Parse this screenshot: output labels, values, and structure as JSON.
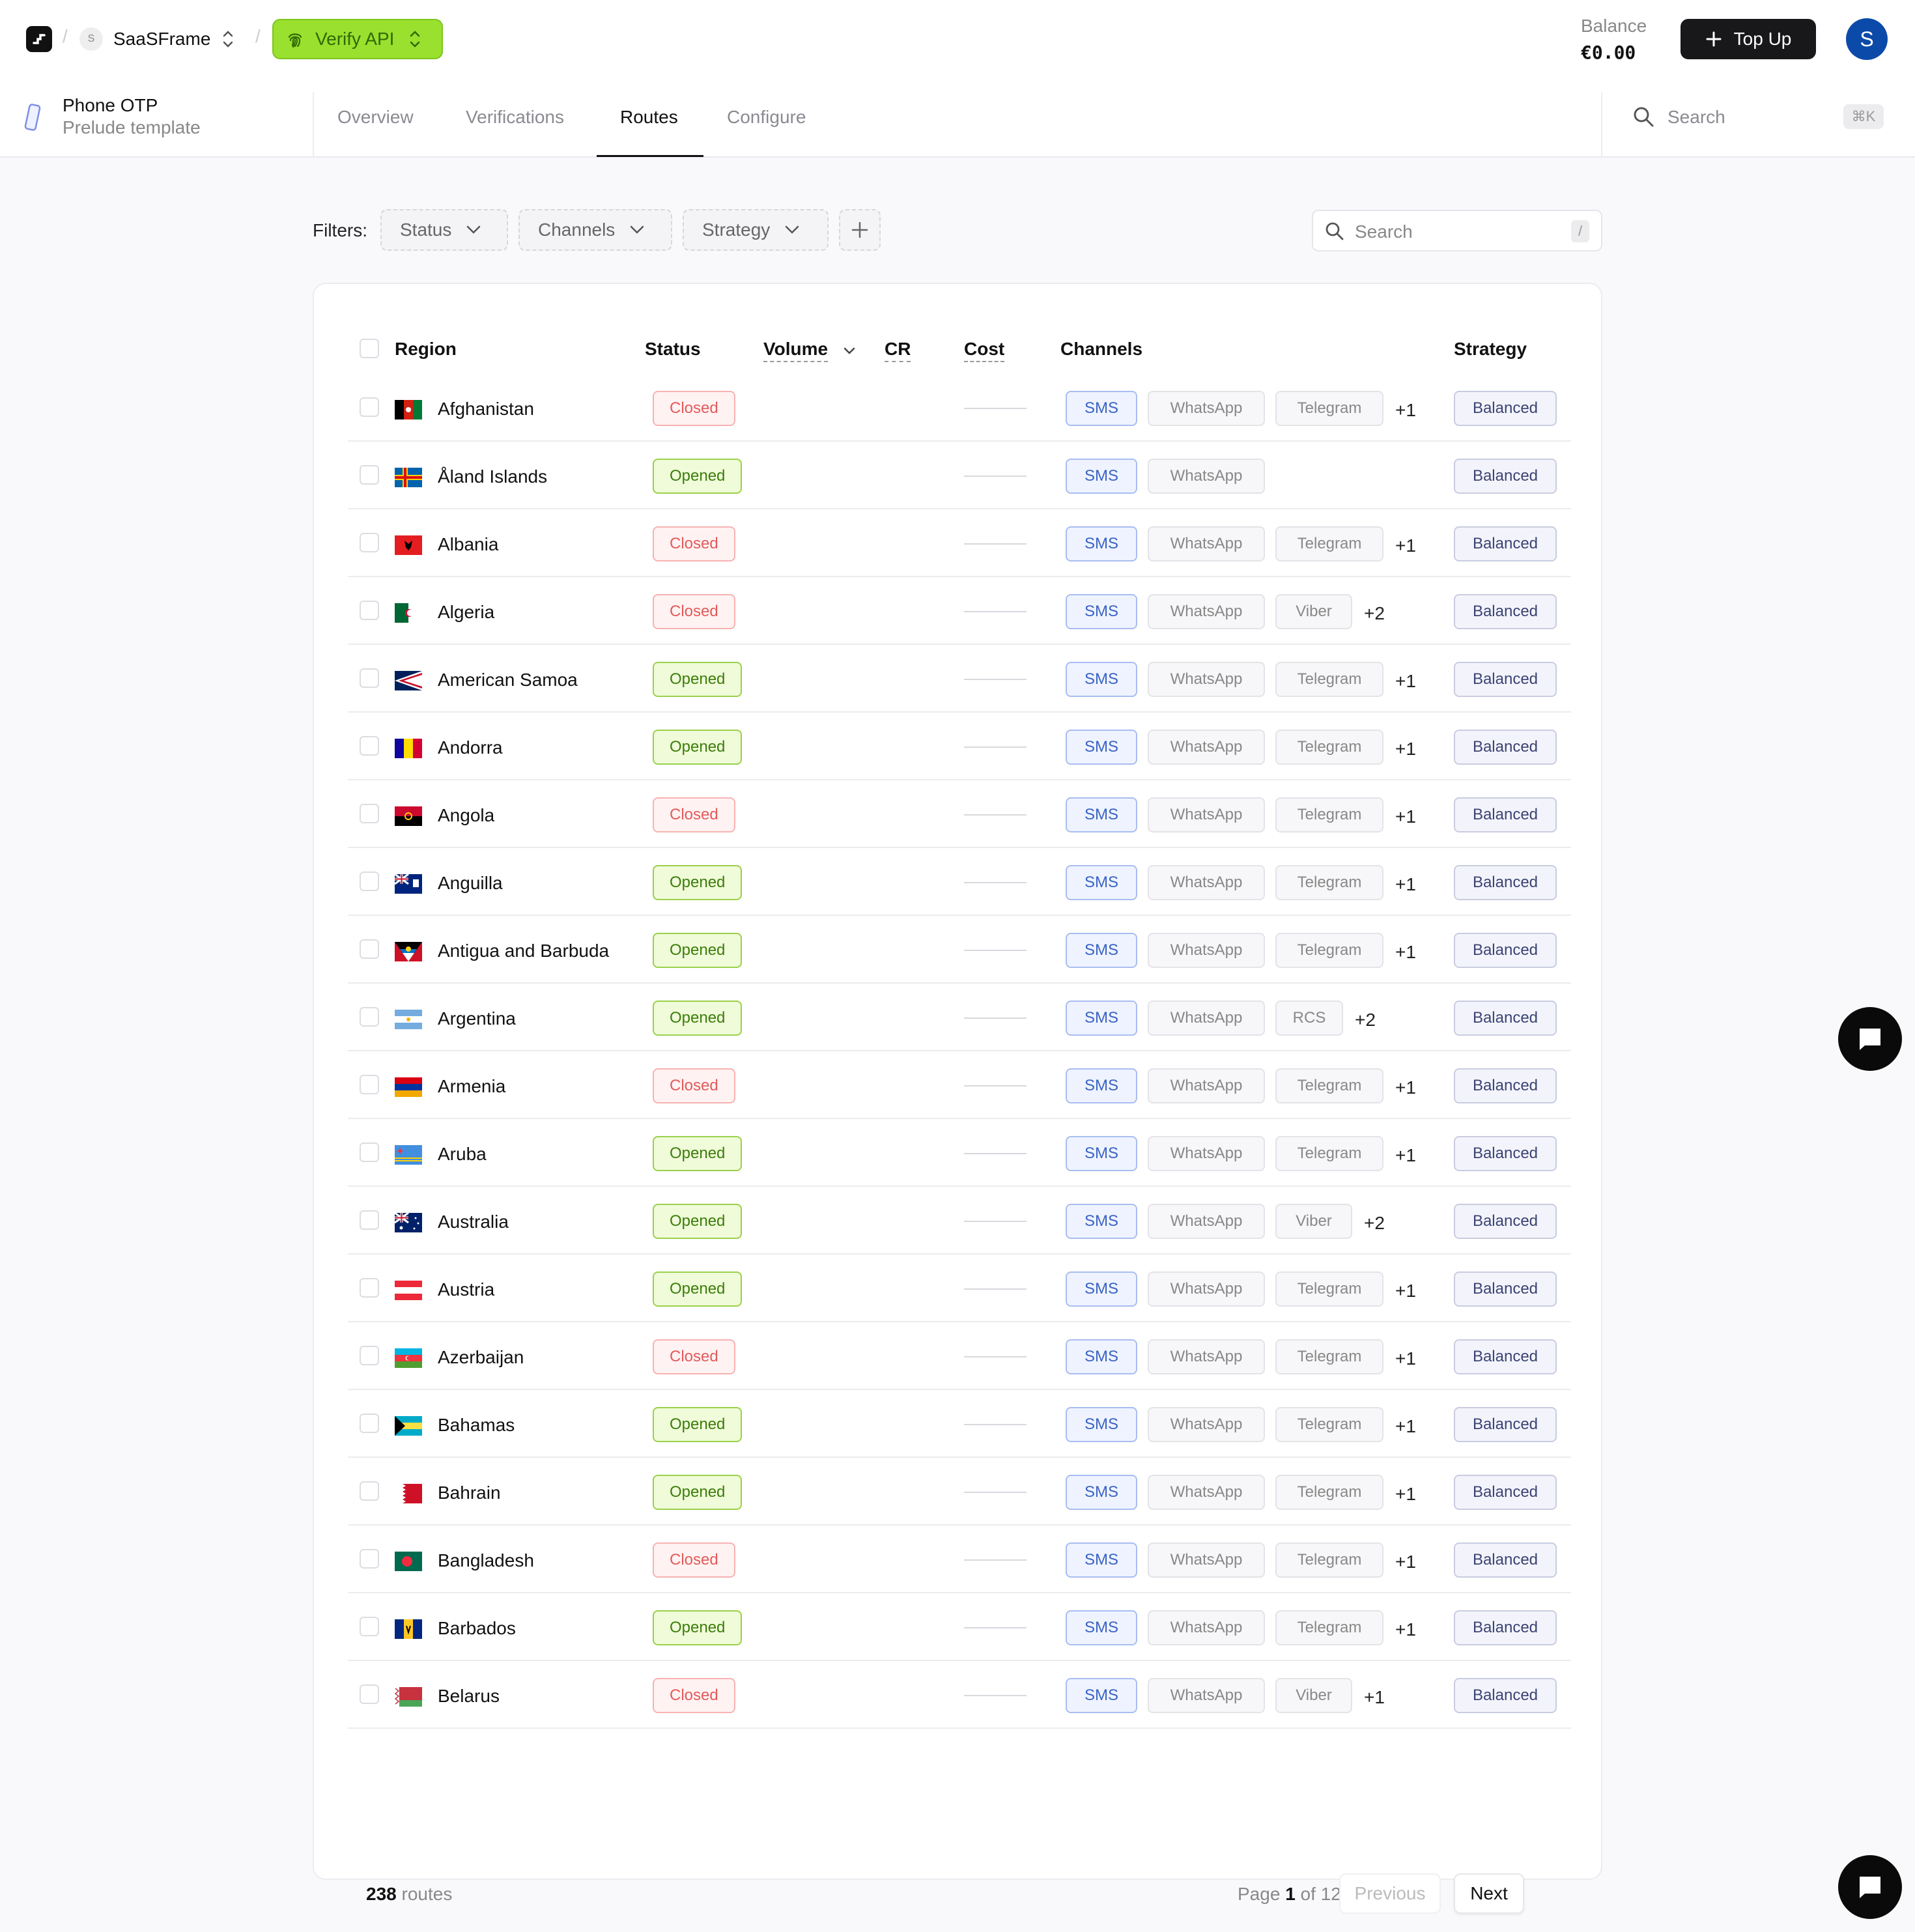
{
  "header": {
    "workspace_initial": "S",
    "workspace_name": "SaaSFrame",
    "product_label": "Verify API",
    "balance_label": "Balance",
    "balance_value": "€0.00",
    "topup_label": "Top Up",
    "user_initial": "S"
  },
  "project": {
    "title": "Phone OTP",
    "subtitle": "Prelude template"
  },
  "tabs": [
    {
      "label": "Overview",
      "active": false
    },
    {
      "label": "Verifications",
      "active": false
    },
    {
      "label": "Routes",
      "active": true
    },
    {
      "label": "Configure",
      "active": false
    }
  ],
  "global_search": {
    "placeholder": "Search",
    "shortcut": "⌘K"
  },
  "filters": {
    "label": "Filters:",
    "chips": [
      "Status",
      "Channels",
      "Strategy"
    ]
  },
  "table_search": {
    "placeholder": "Search",
    "shortcut": "/"
  },
  "table": {
    "columns": {
      "region": "Region",
      "status": "Status",
      "volume": "Volume",
      "cr": "CR",
      "cost": "Cost",
      "channels": "Channels",
      "strategy": "Strategy"
    },
    "rows": [
      {
        "region": "Afghanistan",
        "status": "Closed",
        "channels": [
          "SMS",
          "WhatsApp",
          "Telegram"
        ],
        "more": "+1",
        "strategy": "Balanced",
        "flag": "af"
      },
      {
        "region": "Åland Islands",
        "status": "Opened",
        "channels": [
          "SMS",
          "WhatsApp"
        ],
        "more": "",
        "strategy": "Balanced",
        "flag": "ax"
      },
      {
        "region": "Albania",
        "status": "Closed",
        "channels": [
          "SMS",
          "WhatsApp",
          "Telegram"
        ],
        "more": "+1",
        "strategy": "Balanced",
        "flag": "al"
      },
      {
        "region": "Algeria",
        "status": "Closed",
        "channels": [
          "SMS",
          "WhatsApp",
          "Viber"
        ],
        "more": "+2",
        "strategy": "Balanced",
        "flag": "dz"
      },
      {
        "region": "American Samoa",
        "status": "Opened",
        "channels": [
          "SMS",
          "WhatsApp",
          "Telegram"
        ],
        "more": "+1",
        "strategy": "Balanced",
        "flag": "as"
      },
      {
        "region": "Andorra",
        "status": "Opened",
        "channels": [
          "SMS",
          "WhatsApp",
          "Telegram"
        ],
        "more": "+1",
        "strategy": "Balanced",
        "flag": "ad"
      },
      {
        "region": "Angola",
        "status": "Closed",
        "channels": [
          "SMS",
          "WhatsApp",
          "Telegram"
        ],
        "more": "+1",
        "strategy": "Balanced",
        "flag": "ao"
      },
      {
        "region": "Anguilla",
        "status": "Opened",
        "channels": [
          "SMS",
          "WhatsApp",
          "Telegram"
        ],
        "more": "+1",
        "strategy": "Balanced",
        "flag": "ai"
      },
      {
        "region": "Antigua and Barbuda",
        "status": "Opened",
        "channels": [
          "SMS",
          "WhatsApp",
          "Telegram"
        ],
        "more": "+1",
        "strategy": "Balanced",
        "flag": "ag"
      },
      {
        "region": "Argentina",
        "status": "Opened",
        "channels": [
          "SMS",
          "WhatsApp",
          "RCS"
        ],
        "more": "+2",
        "strategy": "Balanced",
        "flag": "ar"
      },
      {
        "region": "Armenia",
        "status": "Closed",
        "channels": [
          "SMS",
          "WhatsApp",
          "Telegram"
        ],
        "more": "+1",
        "strategy": "Balanced",
        "flag": "am"
      },
      {
        "region": "Aruba",
        "status": "Opened",
        "channels": [
          "SMS",
          "WhatsApp",
          "Telegram"
        ],
        "more": "+1",
        "strategy": "Balanced",
        "flag": "aw"
      },
      {
        "region": "Australia",
        "status": "Opened",
        "channels": [
          "SMS",
          "WhatsApp",
          "Viber"
        ],
        "more": "+2",
        "strategy": "Balanced",
        "flag": "au"
      },
      {
        "region": "Austria",
        "status": "Opened",
        "channels": [
          "SMS",
          "WhatsApp",
          "Telegram"
        ],
        "more": "+1",
        "strategy": "Balanced",
        "flag": "at"
      },
      {
        "region": "Azerbaijan",
        "status": "Closed",
        "channels": [
          "SMS",
          "WhatsApp",
          "Telegram"
        ],
        "more": "+1",
        "strategy": "Balanced",
        "flag": "az"
      },
      {
        "region": "Bahamas",
        "status": "Opened",
        "channels": [
          "SMS",
          "WhatsApp",
          "Telegram"
        ],
        "more": "+1",
        "strategy": "Balanced",
        "flag": "bs"
      },
      {
        "region": "Bahrain",
        "status": "Opened",
        "channels": [
          "SMS",
          "WhatsApp",
          "Telegram"
        ],
        "more": "+1",
        "strategy": "Balanced",
        "flag": "bh"
      },
      {
        "region": "Bangladesh",
        "status": "Closed",
        "channels": [
          "SMS",
          "WhatsApp",
          "Telegram"
        ],
        "more": "+1",
        "strategy": "Balanced",
        "flag": "bd"
      },
      {
        "region": "Barbados",
        "status": "Opened",
        "channels": [
          "SMS",
          "WhatsApp",
          "Telegram"
        ],
        "more": "+1",
        "strategy": "Balanced",
        "flag": "bb"
      },
      {
        "region": "Belarus",
        "status": "Closed",
        "channels": [
          "SMS",
          "WhatsApp",
          "Viber"
        ],
        "more": "+1",
        "strategy": "Balanced",
        "flag": "by"
      }
    ]
  },
  "footer": {
    "routes_count": "238",
    "routes_label": "routes",
    "page_word": "Page",
    "page_current": "1",
    "page_of": "of 12",
    "prev_label": "Previous",
    "next_label": "Next"
  }
}
